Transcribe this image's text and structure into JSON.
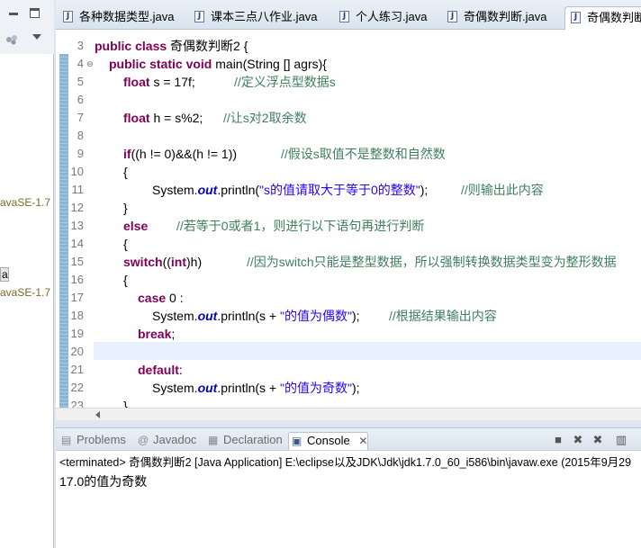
{
  "left_panel": {
    "items": [
      "avaSE-1.7",
      "a",
      "avaSE-1.7"
    ]
  },
  "tabs": [
    {
      "label": "各种数据类型.java"
    },
    {
      "label": "课本三点八作业.java"
    },
    {
      "label": "个人练习.java"
    },
    {
      "label": "奇偶数判断.java"
    },
    {
      "label": "奇偶数判断"
    }
  ],
  "editor": {
    "line_numbers": [
      "3",
      "4",
      "5",
      "6",
      "7",
      "8",
      "9",
      "10",
      "11",
      "12",
      "13",
      "14",
      "15",
      "16",
      "17",
      "18",
      "19",
      "20",
      "21",
      "22",
      "23"
    ],
    "lines": {
      "l3": {
        "kw1": "public class",
        "rest": " 奇偶数判断2 {"
      },
      "l4": {
        "kw1": "public static void",
        "rest": " main(String [] agrs){"
      },
      "l5": {
        "kw1": "float",
        "rest": " s = 17f;",
        "comment": "//定义浮点型数据s"
      },
      "l7": {
        "kw1": "float",
        "rest": " h = s%2;",
        "comment": "//让s对2取余数"
      },
      "l9": {
        "kw1": "if",
        "rest": "((h != 0)&&(h != 1))",
        "comment": "//假设s取值不是整数和自然数"
      },
      "l10": {
        "text": "{"
      },
      "l11": {
        "pre": "System.",
        "field": "out",
        "mid": ".println(",
        "str": "\"s的值请取大于等于0的整数\"",
        "post": ");",
        "comment": "//则输出此内容"
      },
      "l12": {
        "text": "}"
      },
      "l13": {
        "kw1": "else",
        "comment": "//若等于0或者1，则进行以下语句再进行判断"
      },
      "l14": {
        "text": "{"
      },
      "l15": {
        "kw1": "switch",
        "mid1": "((",
        "kw2": "int",
        "mid2": ")h)",
        "comment": "//因为switch只能是整型数据，所以强制转换数据类型变为整形数据"
      },
      "l16": {
        "text": "{"
      },
      "l17": {
        "kw1": "case",
        "rest": " 0 :"
      },
      "l18": {
        "pre": "System.",
        "field": "out",
        "mid": ".println(s + ",
        "str": "\"的值为偶数\"",
        "post": ");",
        "comment": "//根据结果输出内容"
      },
      "l19": {
        "kw1": "break",
        "rest": ";"
      },
      "l21": {
        "kw1": "default",
        "rest": ":"
      },
      "l22": {
        "pre": "System.",
        "field": "out",
        "mid": ".println(s + ",
        "str": "\"的值为奇数\"",
        "post": ");"
      },
      "l23": {
        "text": "}"
      }
    }
  },
  "console": {
    "tabs": [
      "Problems",
      "Javadoc",
      "Declaration",
      "Console"
    ],
    "header": "<terminated> 奇偶数判断2 [Java Application] E:\\eclipse以及JDK\\Jdk\\jdk1.7.0_60_i586\\bin\\javaw.exe (2015年9月29",
    "output": "17.0的值为奇数"
  }
}
